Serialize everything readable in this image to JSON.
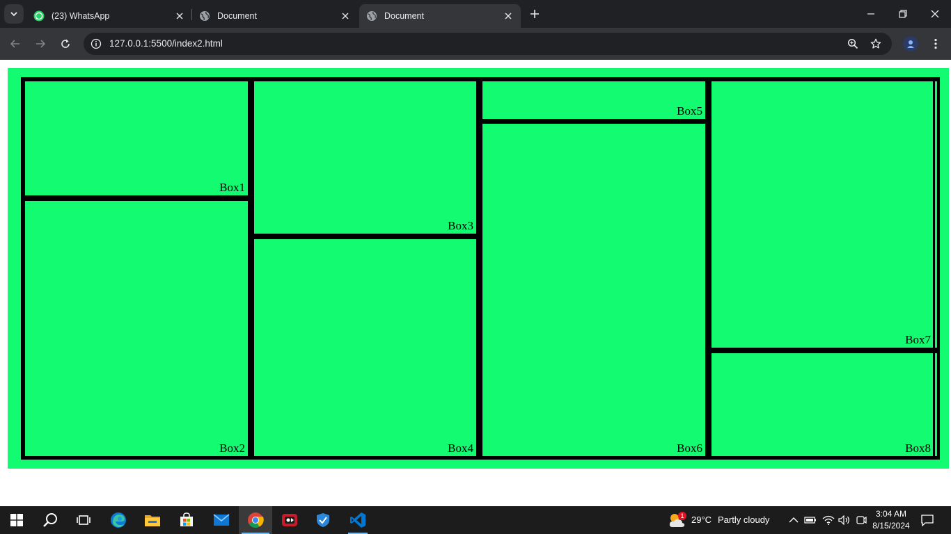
{
  "browser": {
    "tabs": [
      {
        "title": "(23) WhatsApp",
        "icon": "whatsapp-icon",
        "active": false
      },
      {
        "title": "Document",
        "icon": "globe-icon",
        "active": false
      },
      {
        "title": "Document",
        "icon": "globe-icon",
        "active": true
      }
    ],
    "url": "127.0.0.1:5500/index2.html"
  },
  "page": {
    "background_color": "#12fb71",
    "border_color": "#000000",
    "boxes": [
      "Box1",
      "Box2",
      "Box3",
      "Box4",
      "Box5",
      "Box6",
      "Box7",
      "Box8"
    ]
  },
  "taskbar": {
    "apps": [
      "start-icon",
      "search-icon",
      "task-view-icon",
      "edge-icon",
      "file-explorer-icon",
      "store-icon",
      "mail-icon",
      "chrome-icon",
      "screen-recorder-icon",
      "defender-icon",
      "vscode-icon"
    ],
    "weather": {
      "temp": "29°C",
      "condition": "Partly cloudy",
      "badge": "1"
    },
    "time": "3:04 AM",
    "date": "8/15/2024"
  }
}
